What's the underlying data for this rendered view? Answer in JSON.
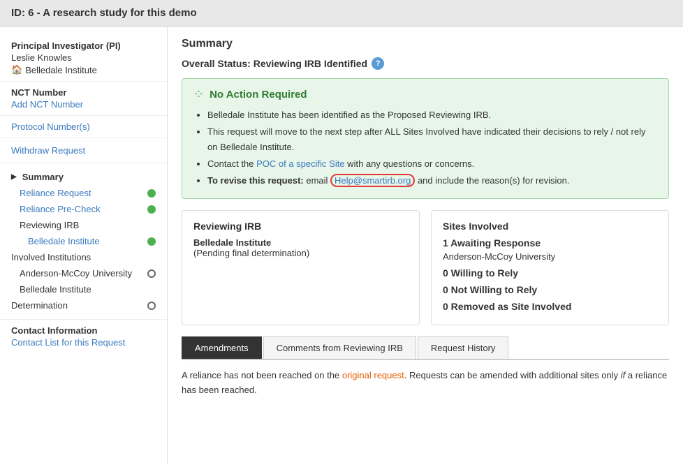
{
  "header": {
    "title": "ID: 6 - A research study for this demo"
  },
  "sidebar": {
    "pi_section": {
      "label": "Principal Investigator (PI)",
      "name": "Leslie Knowles",
      "institution": "Belledale Institute"
    },
    "nct_section": {
      "label": "NCT Number",
      "link": "Add NCT Number"
    },
    "protocol_link": "Protocol Number(s)",
    "withdraw_link": "Withdraw Request",
    "nav_items": [
      {
        "id": "summary",
        "label": "Summary",
        "level": "active",
        "indicator": "none"
      },
      {
        "id": "reliance-request",
        "label": "Reliance Request",
        "level": "sub",
        "indicator": "green"
      },
      {
        "id": "reliance-precheck",
        "label": "Reliance Pre-Check",
        "level": "sub",
        "indicator": "green"
      },
      {
        "id": "reviewing-irb",
        "label": "Reviewing IRB",
        "level": "plain",
        "indicator": "none"
      },
      {
        "id": "belledale-institute-irb",
        "label": "Belledale Institute",
        "level": "sub-sub",
        "indicator": "green"
      },
      {
        "id": "involved-institutions",
        "label": "Involved Institutions",
        "level": "header-level",
        "indicator": "none"
      },
      {
        "id": "anderson-mccoy",
        "label": "Anderson-McCoy University",
        "level": "plain",
        "indicator": "circle"
      },
      {
        "id": "belledale-institute-inst",
        "label": "Belledale Institute",
        "level": "plain",
        "indicator": "none"
      },
      {
        "id": "determination",
        "label": "Determination",
        "level": "header-level",
        "indicator": "circle"
      }
    ],
    "contact_section": {
      "label": "Contact Information",
      "link": "Contact List for this Request"
    }
  },
  "main": {
    "section_title": "Summary",
    "overall_status": "Overall Status: Reviewing IRB Identified",
    "notice": {
      "title": "No Action Required",
      "items": [
        "Belledale Institute has been identified as the Proposed Reviewing IRB.",
        "This request will move to the next step after ALL Sites Involved have indicated their decisions to rely / not rely on Belledale Institute.",
        "Contact the POC of a specific Site with any questions or concerns.",
        "To revise this request: email Help@smartirb.org and include the reason(s) for revision."
      ],
      "email": "Help@smartirb.org",
      "poc_text": "POC of a specific Site"
    },
    "reviewing_irb": {
      "title": "Reviewing IRB",
      "name": "Belledale Institute",
      "status": "(Pending final determination)"
    },
    "sites_involved": {
      "title": "Sites Involved",
      "counts": [
        {
          "label": "1 Awaiting Response",
          "sub": "Anderson-McCoy University"
        },
        {
          "label": "0 Willing to Rely"
        },
        {
          "label": "0 Not Willing to Rely"
        },
        {
          "label": "0 Removed as Site Involved"
        }
      ]
    },
    "tabs": [
      {
        "id": "amendments",
        "label": "Amendments",
        "active": true
      },
      {
        "id": "comments",
        "label": "Comments from Reviewing IRB",
        "active": false
      },
      {
        "id": "history",
        "label": "Request History",
        "active": false
      }
    ],
    "bottom_text_1": "A reliance has not been reached on the original request. Requests can be amended with additional sites only",
    "bottom_text_italic": "if",
    "bottom_text_2": "a reliance has been reached."
  }
}
